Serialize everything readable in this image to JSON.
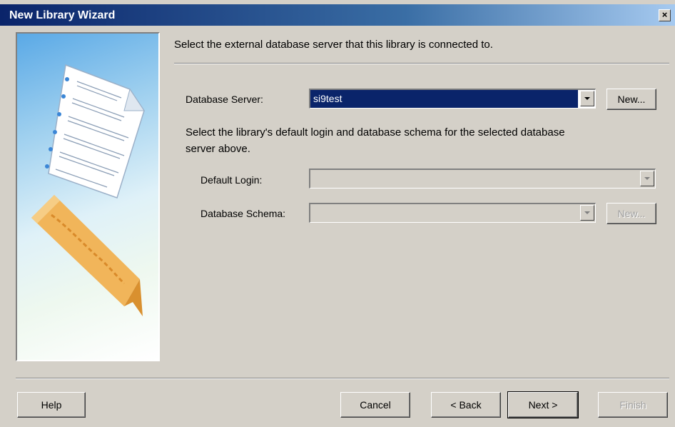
{
  "window": {
    "title": "New Library Wizard",
    "close_symbol": "×"
  },
  "main": {
    "instruction": "Select the external database server that this library is connected to.",
    "database_server": {
      "label": "Database Server:",
      "value": "si9test",
      "new_button": "New..."
    },
    "schema_instruction_line1": "Select the library's default login and database schema for the selected database",
    "schema_instruction_line2": "server above.",
    "default_login": {
      "label": "Default Login:",
      "value": "",
      "enabled": false
    },
    "database_schema": {
      "label": "Database Schema:",
      "value": "",
      "enabled": false,
      "new_button": "New..."
    }
  },
  "footer": {
    "help": "Help",
    "cancel": "Cancel",
    "back": "< Back",
    "next": "Next >",
    "finish": "Finish"
  },
  "colors": {
    "titlebar_start": "#0a246a",
    "selection": "#0a246a",
    "dialog_face": "#d4d0c8"
  }
}
